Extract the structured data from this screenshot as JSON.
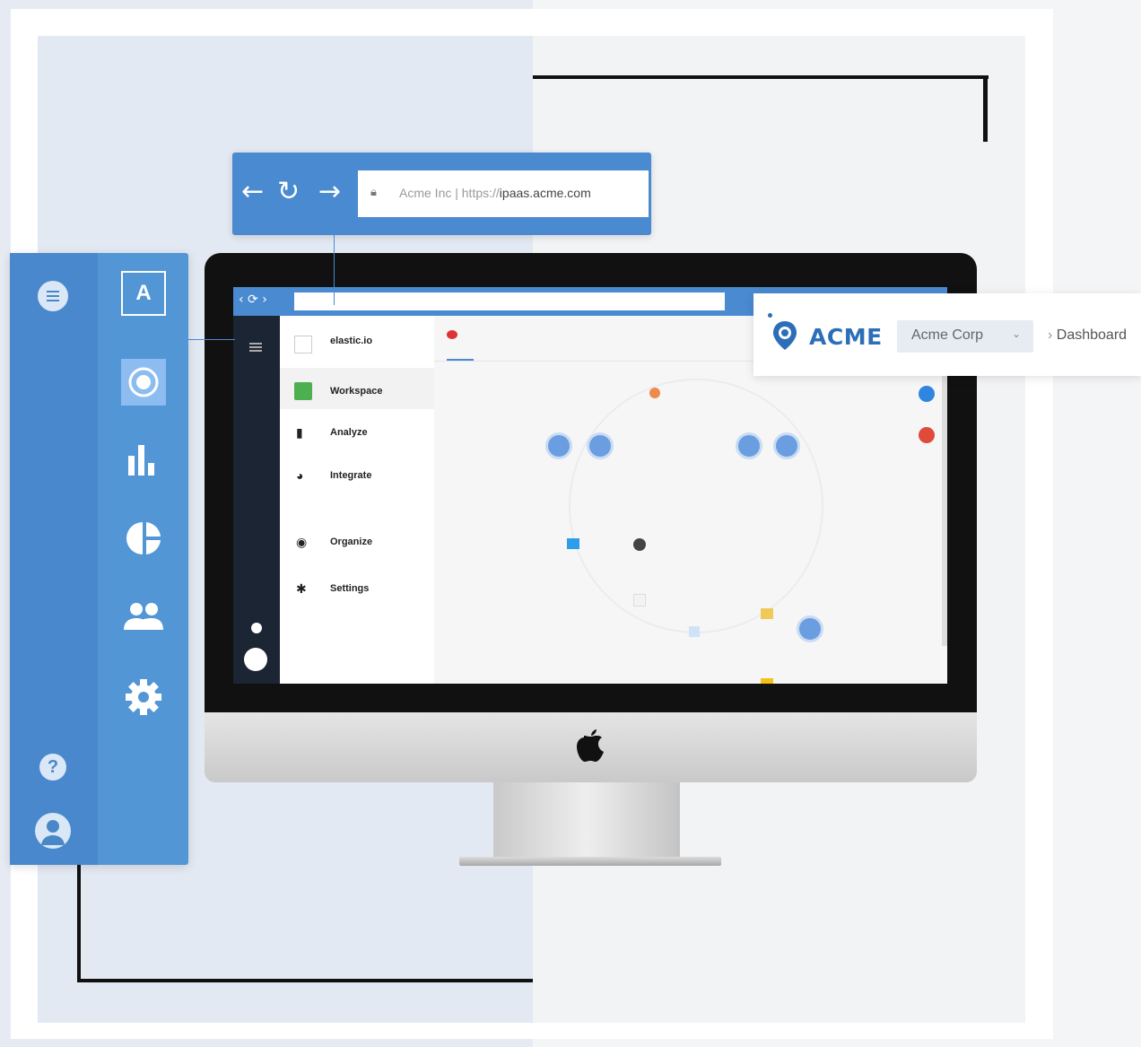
{
  "browser_bar": {
    "back_icon": "arrow-left-icon",
    "reload_icon": "reload-icon",
    "forward_icon": "arrow-right-icon",
    "url_prefix": "Acme Inc | https://",
    "url_domain": "ipaas.acme.com"
  },
  "sidebar": {
    "logo_letter": "A",
    "icons": [
      "menu-icon",
      "target-icon",
      "bar-chart-icon",
      "pie-chart-icon",
      "users-icon",
      "gear-icon",
      "help-icon",
      "user-icon"
    ]
  },
  "header": {
    "brand": "ACME",
    "org_select": "Acme Corp",
    "breadcrumb": "Dashboard"
  },
  "screen": {
    "workspace_name": "elastic.io",
    "menu": [
      {
        "label": "Workspace"
      },
      {
        "label": "Analyze"
      },
      {
        "label": "Integrate"
      },
      {
        "label": "Organize"
      },
      {
        "label": "Settings"
      }
    ]
  },
  "colors": {
    "accent": "#4a8ad0",
    "sidebar": "#5296d6",
    "brand": "#2c6fb8"
  }
}
